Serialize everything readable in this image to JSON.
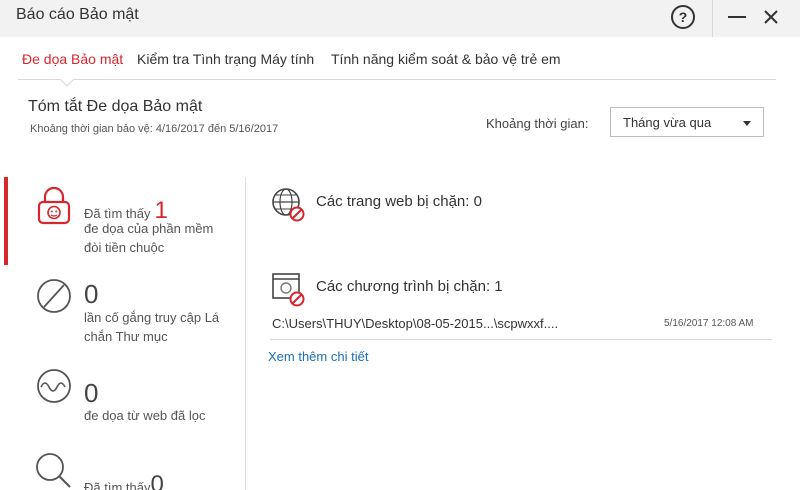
{
  "window": {
    "title": "Báo cáo Bảo mật",
    "help_label": "?"
  },
  "tabs": [
    {
      "label": "Đe dọa Bảo mật",
      "active": true
    },
    {
      "label": "Kiểm tra Tình trạng Máy tính",
      "active": false
    },
    {
      "label": "Tính năng kiểm soát & bảo vệ trẻ em",
      "active": false
    }
  ],
  "summary": {
    "title": "Tóm tắt Đe dọa Bảo mật",
    "period": "Khoảng thời gian bảo vệ: 4/16/2017 đến 5/16/2017",
    "range_label": "Khoảng thời gian:",
    "range_value": "Tháng vừa qua"
  },
  "stats": [
    {
      "icon": "lock-icon",
      "prefix": "Đã tìm thấy",
      "count": "1",
      "line1": "đe dọa của phần mềm",
      "line2": "đòi tiền chuộc"
    },
    {
      "icon": "blocked-circle-icon",
      "count": "0",
      "line1": "lần cố gắng truy cập Lá",
      "line2": "chắn Thư mục"
    },
    {
      "icon": "web-wave-icon",
      "count": "0",
      "line1": "đe dọa từ web đã lọc"
    },
    {
      "icon": "magnifier-icon",
      "prefix": "Đã tìm thấy",
      "count": "0"
    }
  ],
  "blocked": {
    "websites": "Các trang web bị chặn: 0",
    "programs": "Các chương trình bị chặn: 1",
    "program_path": "C:\\Users\\THUY\\Desktop\\08-05-2015...\\scpwxxf....",
    "program_time": "5/16/2017 12:08 AM",
    "more_link": "Xem thêm chi tiết"
  },
  "colors": {
    "accent": "#d6262e",
    "link": "#1a6fb5"
  }
}
